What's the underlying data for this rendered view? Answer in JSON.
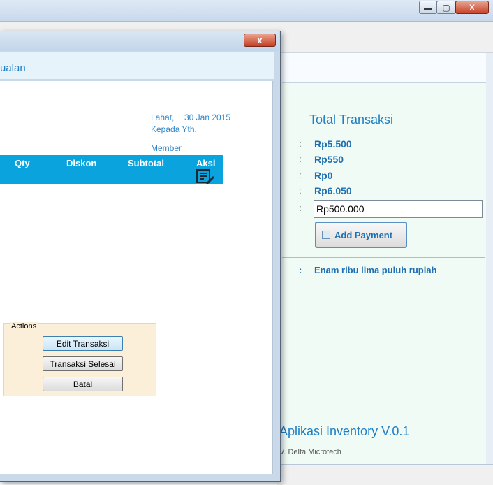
{
  "main_window": {
    "controls": {
      "minimize": "▬",
      "maximize": "▢",
      "close": "X"
    },
    "total_transaksi": {
      "title": "Total Transaksi",
      "colon": ":",
      "values": [
        "Rp5.500",
        "Rp550",
        "Rp0",
        "Rp6.050"
      ],
      "payment_value": "Rp500.000",
      "add_payment_label": "Add Payment",
      "terbilang": "Enam ribu lima puluh rupiah"
    },
    "footer": {
      "app_name": "Aplikasi Inventory V.0.1",
      "copyright": "V. Delta Microtech"
    }
  },
  "dialog": {
    "title_partial": "ualan",
    "close_label": "x",
    "invoice": {
      "location": "Lahat,",
      "date": "30 Jan 2015",
      "to_label": "Kepada Yth.",
      "member_label": "Member"
    },
    "grid_columns": [
      "Qty",
      "Diskon",
      "Subtotal",
      "Aksi"
    ],
    "actions": {
      "legend": "Actions",
      "edit_label": "Edit Transaksi",
      "finish_label": "Transaksi Selesai",
      "cancel_label": "Batal"
    }
  }
}
